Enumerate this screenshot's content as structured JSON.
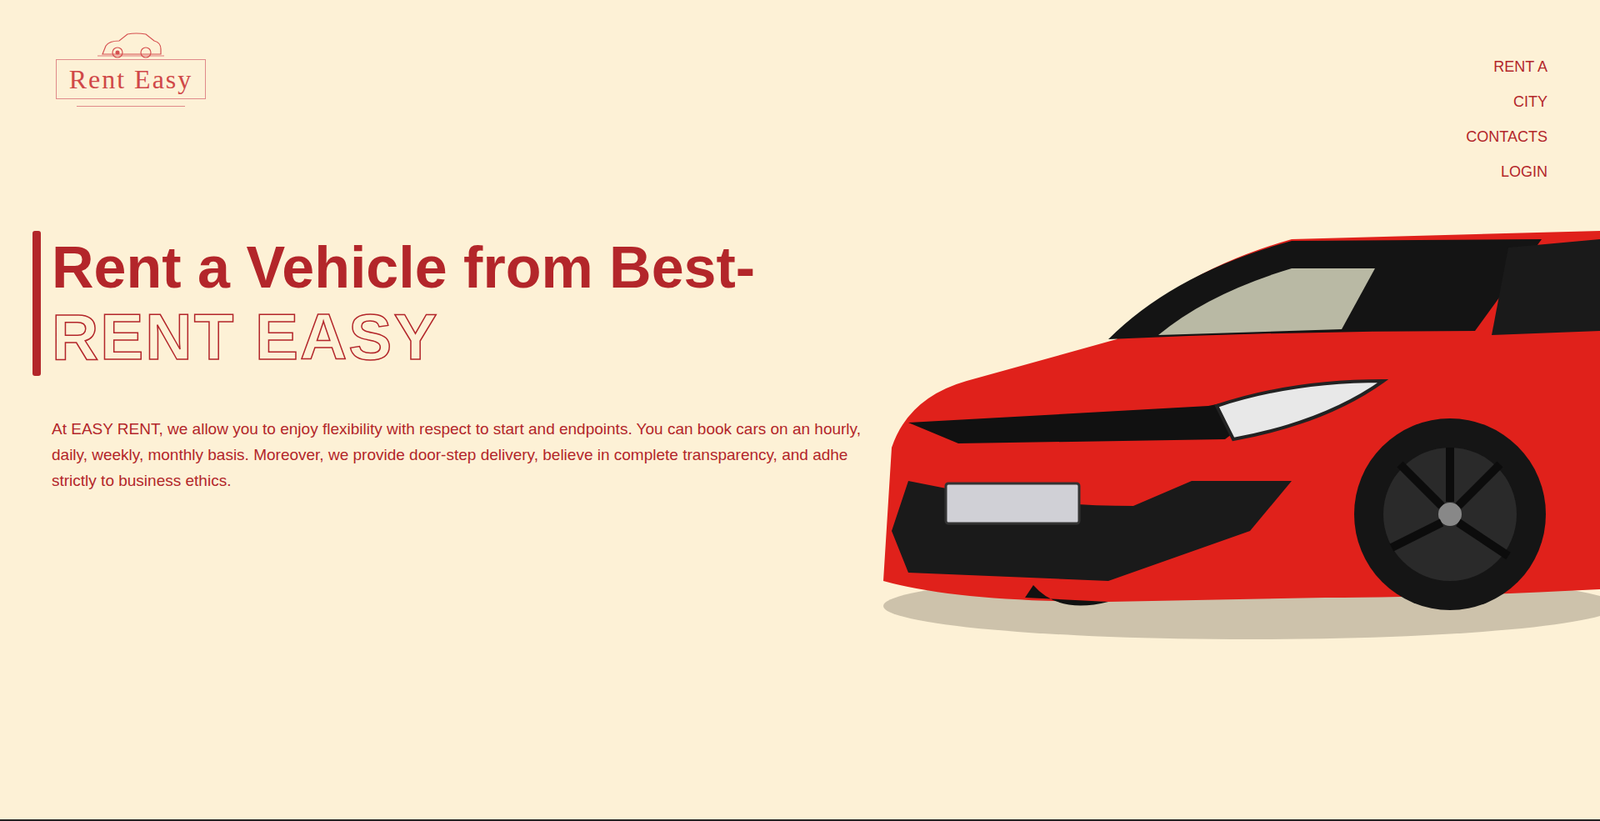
{
  "logo": {
    "text": "Rent Easy"
  },
  "nav": [
    {
      "label": "RENT A"
    },
    {
      "label": "CITY"
    },
    {
      "label": "CONTACTS"
    },
    {
      "label": "LOGIN"
    }
  ],
  "hero": {
    "title": "Rent a Vehicle from Best-",
    "subtitle": "RENT EASY",
    "paragraph_lines": [
      "At EASY RENT, we allow you to enjoy flexibility with respect to start and endpoints. You can book cars on an hourly,",
      "daily, weekly, monthly basis. Moreover, we provide door-step delivery, believe in complete transparency, and adhe",
      "strictly to business ethics."
    ]
  }
}
